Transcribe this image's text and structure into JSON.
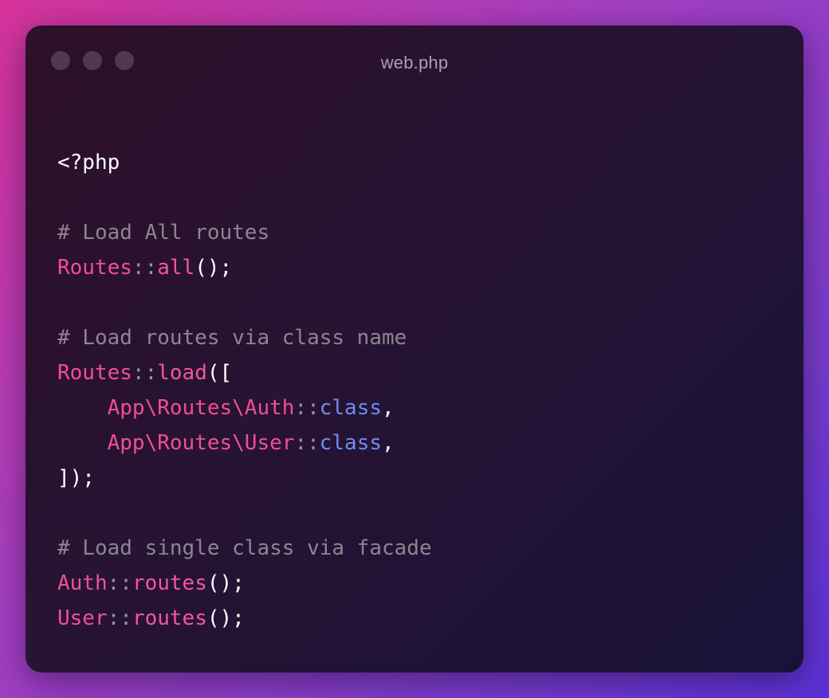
{
  "window": {
    "title": "web.php",
    "controls": [
      "close-dot",
      "minimize-dot",
      "maximize-dot"
    ]
  },
  "code": {
    "lines": [
      [
        {
          "t": "<?php",
          "c": "white"
        }
      ],
      [],
      [
        {
          "t": "# Load All routes",
          "c": "comment"
        }
      ],
      [
        {
          "t": "Routes",
          "c": "pink"
        },
        {
          "t": "::",
          "c": "sep"
        },
        {
          "t": "all",
          "c": "pink2"
        },
        {
          "t": "();",
          "c": "white"
        }
      ],
      [],
      [
        {
          "t": "# Load routes via class name",
          "c": "comment"
        }
      ],
      [
        {
          "t": "Routes",
          "c": "pink"
        },
        {
          "t": "::",
          "c": "sep"
        },
        {
          "t": "load",
          "c": "pink2"
        },
        {
          "t": "([",
          "c": "white"
        }
      ],
      [
        {
          "t": "    ",
          "c": "white"
        },
        {
          "t": "App\\Routes\\Auth",
          "c": "pink"
        },
        {
          "t": "::",
          "c": "sep"
        },
        {
          "t": "class",
          "c": "blue"
        },
        {
          "t": ",",
          "c": "white"
        }
      ],
      [
        {
          "t": "    ",
          "c": "white"
        },
        {
          "t": "App\\Routes\\User",
          "c": "pink"
        },
        {
          "t": "::",
          "c": "sep"
        },
        {
          "t": "class",
          "c": "blue"
        },
        {
          "t": ",",
          "c": "white"
        }
      ],
      [
        {
          "t": "]);",
          "c": "white"
        }
      ],
      [],
      [
        {
          "t": "# Load single class via facade",
          "c": "comment"
        }
      ],
      [
        {
          "t": "Auth",
          "c": "pink"
        },
        {
          "t": "::",
          "c": "sep"
        },
        {
          "t": "routes",
          "c": "pink2"
        },
        {
          "t": "();",
          "c": "white"
        }
      ],
      [
        {
          "t": "User",
          "c": "pink"
        },
        {
          "t": "::",
          "c": "sep"
        },
        {
          "t": "routes",
          "c": "pink2"
        },
        {
          "t": "();",
          "c": "white"
        }
      ]
    ]
  },
  "colors": {
    "background_start": "#d6339a",
    "background_end": "#5a31d6",
    "window_bg": "#271333",
    "keyword_pink": "#f14e97",
    "class_blue": "#6d8cf0",
    "comment_gray": "#8e8590"
  }
}
